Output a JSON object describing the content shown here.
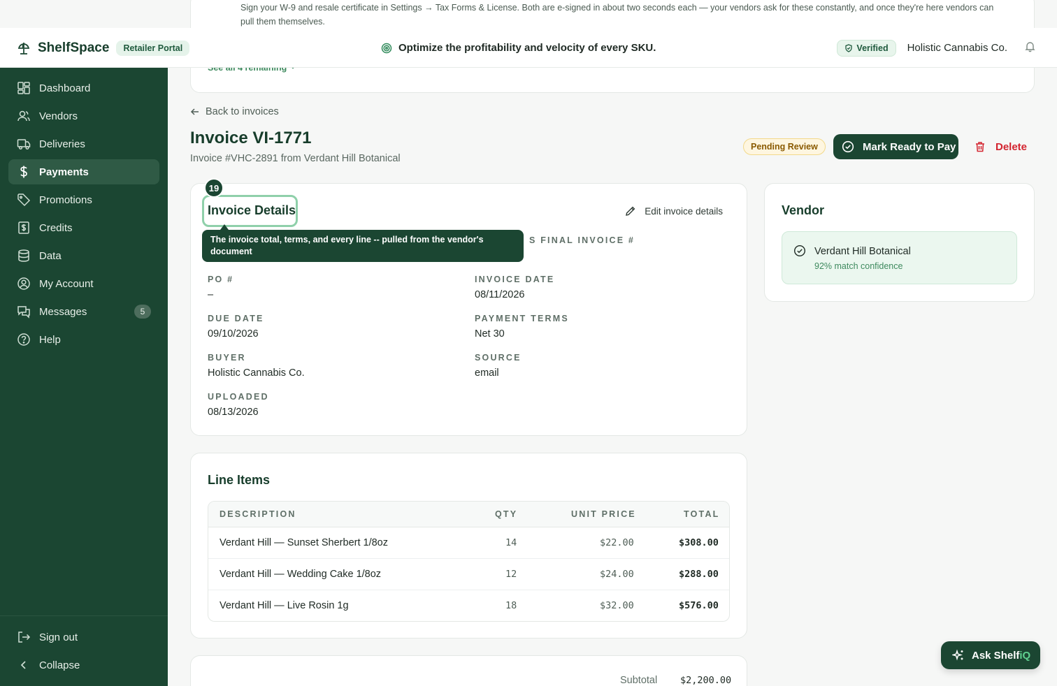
{
  "banner": {
    "text": "Sign your W-9 and resale certificate in Settings → Tax Forms & License. Both are e-signed in about two seconds each — your vendors ask for these constantly, and once they're here vendors can pull them themselves.",
    "see_all": "See all 4 remaining"
  },
  "topbar": {
    "brand": "ShelfSpace",
    "portal_badge": "Retailer Portal",
    "tagline": "Optimize the profitability and velocity of every SKU.",
    "verified": "Verified",
    "company": "Holistic Cannabis Co."
  },
  "sidebar": {
    "items": [
      {
        "label": "Dashboard",
        "icon": "dashboard-icon"
      },
      {
        "label": "Vendors",
        "icon": "users-icon"
      },
      {
        "label": "Deliveries",
        "icon": "truck-icon"
      },
      {
        "label": "Payments",
        "icon": "dollar-icon",
        "active": true
      },
      {
        "label": "Promotions",
        "icon": "tag-icon"
      },
      {
        "label": "Credits",
        "icon": "receipt-icon"
      },
      {
        "label": "Data",
        "icon": "database-icon"
      },
      {
        "label": "My Account",
        "icon": "user-circle-icon"
      },
      {
        "label": "Messages",
        "icon": "messages-icon",
        "count": "5"
      },
      {
        "label": "Help",
        "icon": "help-icon"
      }
    ],
    "sign_out": "Sign out",
    "collapse": "Collapse"
  },
  "page": {
    "back": "Back to invoices",
    "title": "Invoice VI-1771",
    "subtitle": "Invoice #VHC-2891 from Verdant Hill Botanical",
    "status": "Pending Review",
    "ready_button": "Mark Ready to Pay",
    "delete_button": "Delete"
  },
  "details": {
    "title": "Invoice Details",
    "step": "19",
    "edit": "Edit invoice details",
    "tooltip": "The invoice total, terms, and every line -- pulled from the vendor's document",
    "hidden_label_fragment": "S FINAL INVOICE #",
    "fields": {
      "po_label": "PO #",
      "po_value": "–",
      "invoice_date_label": "INVOICE DATE",
      "invoice_date_value": "08/11/2026",
      "due_date_label": "DUE DATE",
      "due_date_value": "09/10/2026",
      "terms_label": "PAYMENT TERMS",
      "terms_value": "Net 30",
      "buyer_label": "BUYER",
      "buyer_value": "Holistic Cannabis Co.",
      "source_label": "SOURCE",
      "source_value": "email",
      "uploaded_label": "UPLOADED",
      "uploaded_value": "08/13/2026"
    }
  },
  "vendor": {
    "title": "Vendor",
    "name": "Verdant Hill Botanical",
    "confidence": "92% match confidence"
  },
  "lines": {
    "title": "Line Items",
    "headers": {
      "description": "DESCRIPTION",
      "qty": "QTY",
      "unit_price": "UNIT PRICE",
      "total": "TOTAL"
    },
    "rows": [
      {
        "description": "Verdant Hill — Sunset Sherbert 1/8oz",
        "qty": "14",
        "unit_price": "$22.00",
        "total": "$308.00"
      },
      {
        "description": "Verdant Hill — Wedding Cake 1/8oz",
        "qty": "12",
        "unit_price": "$24.00",
        "total": "$288.00"
      },
      {
        "description": "Verdant Hill — Live Rosin 1g",
        "qty": "18",
        "unit_price": "$32.00",
        "total": "$576.00"
      }
    ]
  },
  "totals": {
    "subtotal_label": "Subtotal",
    "subtotal_value": "$2,200.00"
  },
  "assistant": {
    "label_main": "Ask Shelf",
    "label_accent": "iQ"
  }
}
